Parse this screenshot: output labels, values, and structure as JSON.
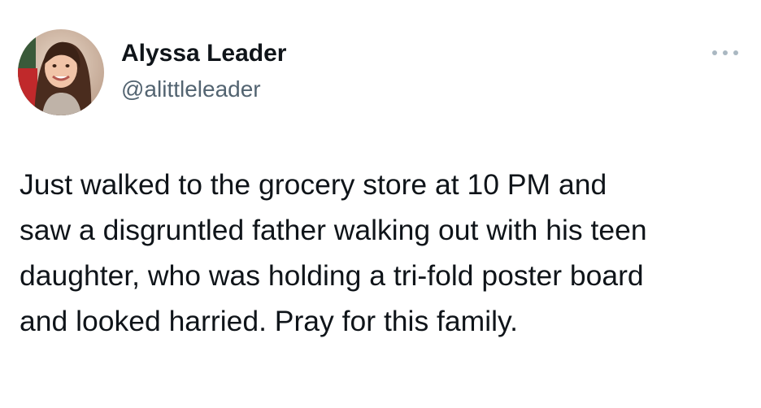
{
  "author": {
    "display_name": "Alyssa Leader",
    "handle": "@alittleleader",
    "avatar_icon": "profile-photo"
  },
  "menu": {
    "icon": "more-horizontal-icon"
  },
  "tweet": {
    "lines": [
      "Just walked to the grocery store at 10 PM and",
      "saw a disgruntled father walking out with his teen",
      "daughter, who was holding a tri-fold poster board",
      "and looked harried. Pray for this family."
    ]
  },
  "colors": {
    "text_primary": "#0f1419",
    "text_secondary": "#536471",
    "icon_muted": "#aab8c2",
    "background": "#ffffff"
  }
}
